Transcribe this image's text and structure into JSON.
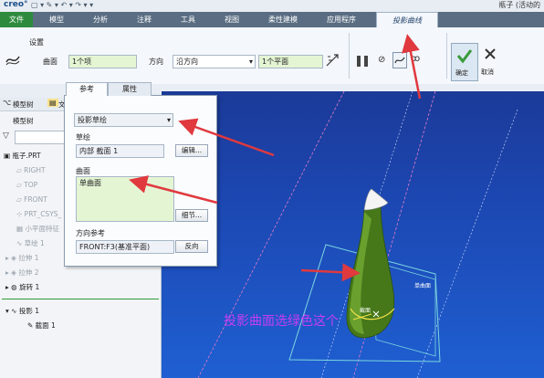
{
  "app": {
    "logo": "creo°",
    "window_title": "瓶子 (活动的"
  },
  "tabs": [
    {
      "label": "文件"
    },
    {
      "label": "模型"
    },
    {
      "label": "分析"
    },
    {
      "label": "注释"
    },
    {
      "label": "工具"
    },
    {
      "label": "视图"
    },
    {
      "label": "柔性建模"
    },
    {
      "label": "应用程序"
    },
    {
      "label": "投影曲线"
    }
  ],
  "ribbon": {
    "group_label": "设置",
    "surface_label": "曲面",
    "surface_value": "1个项",
    "direction_label": "方向",
    "direction_value": "沿方向",
    "direction_ref": "1个平面",
    "confirm_label": "确定",
    "cancel_label": "取消"
  },
  "tree": {
    "tab_model": "模型树",
    "tab_other": "文",
    "header": "模型树",
    "root": "瓶子.PRT",
    "items": [
      "RIGHT",
      "TOP",
      "FRONT",
      "PRT_CSYS_",
      "小平面特征",
      "草绘 1",
      "拉伸 1",
      "拉伸 2",
      "旋转 1",
      "投影 1",
      "截面 1"
    ]
  },
  "panel": {
    "tab_refs": "参考",
    "tab_props": "属性",
    "type_value": "投影草绘",
    "sketch_label": "草绘",
    "sketch_value": "内部 截面 1",
    "edit_button": "编辑...",
    "surface_label": "曲面",
    "surface_value": "单曲面",
    "details_button": "细节...",
    "direction_label": "方向参考",
    "direction_value": "FRONT:F3(基准平面)",
    "reverse_button": "反向"
  },
  "viewport": {
    "single_surface_tag": "单曲面",
    "section_tag": "截面",
    "annotation": "投影曲面选绿色这个"
  },
  "colors": {
    "arrow": "#e0393e",
    "annotation": "#c43ef2",
    "model_green": "#4a7a1e"
  }
}
